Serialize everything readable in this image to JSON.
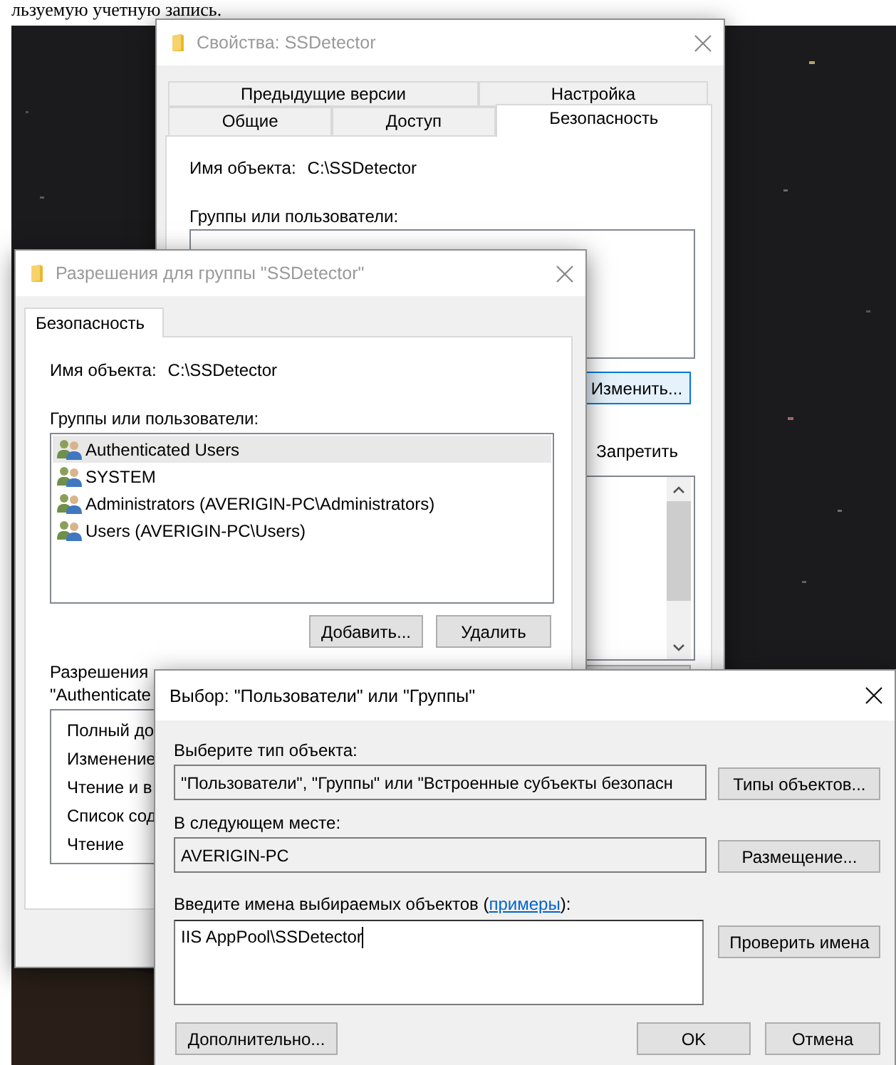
{
  "caption": "льзуемую учетную запись.",
  "properties_window": {
    "title": "Свойства: SSDetector",
    "active": false,
    "tab_rows": [
      [
        {
          "label": "Предыдущие версии",
          "selected": false
        },
        {
          "label": "Настройка",
          "selected": false
        }
      ],
      [
        {
          "label": "Общие",
          "selected": false
        },
        {
          "label": "Доступ",
          "selected": false
        },
        {
          "label": "Безопасность",
          "selected": true
        }
      ]
    ],
    "object_label": "Имя объекта:",
    "object_value": "C:\\SSDetector",
    "groups_label": "Группы или пользователи:",
    "edit_button": "Изменить...",
    "deny_label": "Запретить"
  },
  "permissions_window": {
    "title": "Разрешения для группы \"SSDetector\"",
    "active": false,
    "tabs": [
      {
        "label": "Безопасность",
        "selected": true
      }
    ],
    "object_label": "Имя объекта:",
    "object_value": "C:\\SSDetector",
    "groups_label": "Группы или пользователи:",
    "users": [
      {
        "name": "Authenticated Users",
        "selected": true
      },
      {
        "name": "SYSTEM",
        "selected": false
      },
      {
        "name": "Administrators (AVERIGIN-PC\\Administrators)",
        "selected": false
      },
      {
        "name": "Users (AVERIGIN-PC\\Users)",
        "selected": false
      }
    ],
    "add_button": "Добавить...",
    "remove_button": "Удалить",
    "permissions_label": [
      "Разрешения",
      "\"Authenticate"
    ],
    "permissions": [
      "Полный до",
      "Изменение",
      "Чтение и в",
      "Список сод",
      "Чтение"
    ]
  },
  "select_dialog": {
    "title": "Выбор: \"Пользователи\" или \"Группы\"",
    "active": true,
    "object_type_label": "Выберите тип объекта:",
    "object_type_value": "\"Пользователи\", \"Группы\" или \"Встроенные субъекты безопасн",
    "object_types_button": "Типы объектов...",
    "location_label": "В следующем месте:",
    "location_value": "AVERIGIN-PC",
    "location_button": "Размещение...",
    "names_label": "Введите имена выбираемых объектов (",
    "examples_link": "примеры",
    "names_label_end": "):",
    "names_value": "IIS AppPool\\SSDetector",
    "check_names_button": "Проверить имена",
    "advanced_button": "Дополнительно...",
    "ok_button": "OK",
    "cancel_button": "Отмена"
  }
}
